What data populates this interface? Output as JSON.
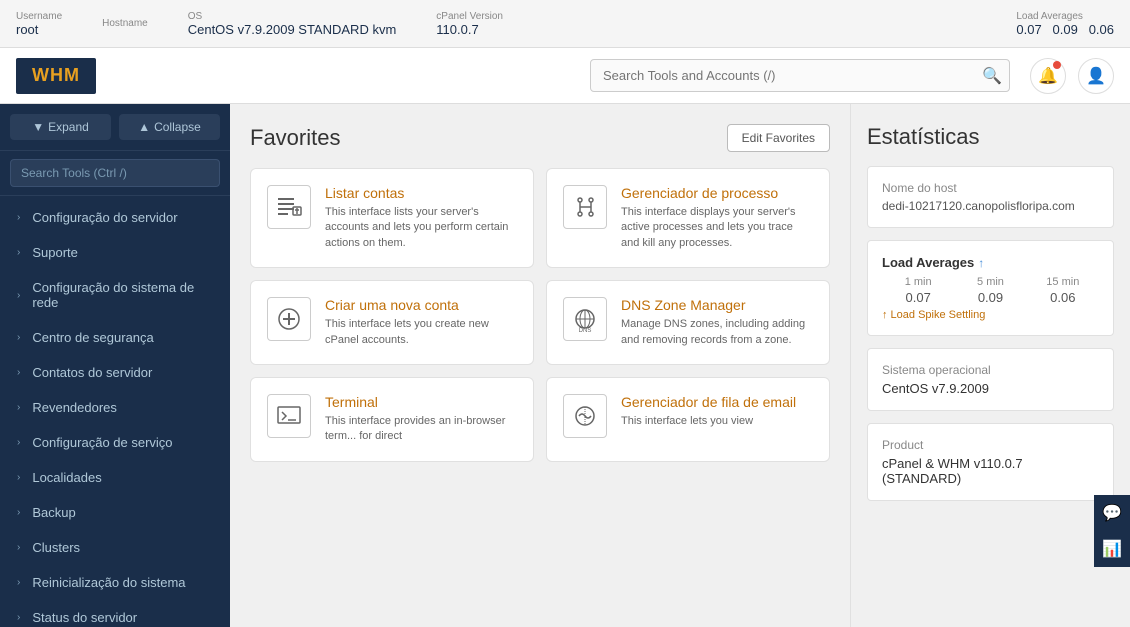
{
  "topbar": {
    "username_label": "Username",
    "username_value": "root",
    "hostname_label": "Hostname",
    "hostname_value": "",
    "os_label": "OS",
    "os_value": "CentOS v7.9.2009 STANDARD kvm",
    "cpanel_label": "cPanel Version",
    "cpanel_value": "110.0.7",
    "load_label": "Load Averages",
    "load_1": "0.07",
    "load_5": "0.09",
    "load_15": "0.06"
  },
  "header": {
    "logo_text": "WHM",
    "search_placeholder": "Search Tools and Accounts (/)"
  },
  "sidebar": {
    "expand_btn": "Expand",
    "collapse_btn": "Collapse",
    "search_placeholder": "Search Tools (Ctrl /)",
    "nav_items": [
      {
        "label": "Configuração do servidor"
      },
      {
        "label": "Suporte"
      },
      {
        "label": "Configuração do sistema de rede"
      },
      {
        "label": "Centro de segurança"
      },
      {
        "label": "Contatos do servidor"
      },
      {
        "label": "Revendedores"
      },
      {
        "label": "Configuração de serviço"
      },
      {
        "label": "Localidades"
      },
      {
        "label": "Backup"
      },
      {
        "label": "Clusters"
      },
      {
        "label": "Reinicialização do sistema"
      },
      {
        "label": "Status do servidor"
      }
    ]
  },
  "favorites": {
    "title": "Favorites",
    "edit_btn": "Edit Favorites",
    "items": [
      {
        "title": "Listar contas",
        "desc": "This interface lists your server's accounts and lets you perform certain actions on them.",
        "icon": "list"
      },
      {
        "title": "Gerenciador de processo",
        "desc": "This interface displays your server's active processes and lets you trace and kill any processes.",
        "icon": "process"
      },
      {
        "title": "Criar uma nova conta",
        "desc": "This interface lets you create new cPanel accounts.",
        "icon": "add"
      },
      {
        "title": "DNS Zone Manager",
        "desc": "Manage DNS zones, including adding and removing records from a zone.",
        "icon": "dns"
      },
      {
        "title": "Terminal",
        "desc": "This interface provides an in-browser term... for direct",
        "icon": "terminal"
      },
      {
        "title": "Gerenciador de fila de email",
        "desc": "This interface lets you view",
        "icon": "email"
      }
    ]
  },
  "stats": {
    "title": "Estatísticas",
    "hostname_label": "Nome do host",
    "hostname_value": "dedi-10217120.canopolisfloripa.com",
    "load_averages_label": "Load Averages",
    "load_1_label": "1 min",
    "load_5_label": "5 min",
    "load_15_label": "15 min",
    "load_1_value": "0.07",
    "load_5_value": "0.09",
    "load_15_value": "0.06",
    "load_spike_text": "↑ Load Spike Settling",
    "os_label": "Sistema operacional",
    "os_value": "CentOS v7.9.2009",
    "product_label": "Product",
    "product_value": "cPanel & WHM v110.0.7 (STANDARD)"
  }
}
